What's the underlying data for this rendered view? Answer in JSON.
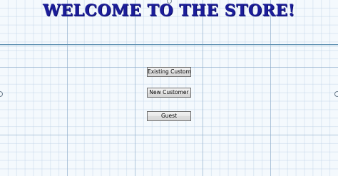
{
  "title": "Welcome to the Store!",
  "buttons": {
    "existing_customer": "Existing Customer",
    "new_customer": "New Customer",
    "guest": "Guest"
  },
  "colors": {
    "title": "#1b1d9a",
    "background": "#f4f9fd",
    "grid_major": "#8caac8",
    "grid_minor": "#bed2e6",
    "guide_line": "#5d8fb0"
  }
}
